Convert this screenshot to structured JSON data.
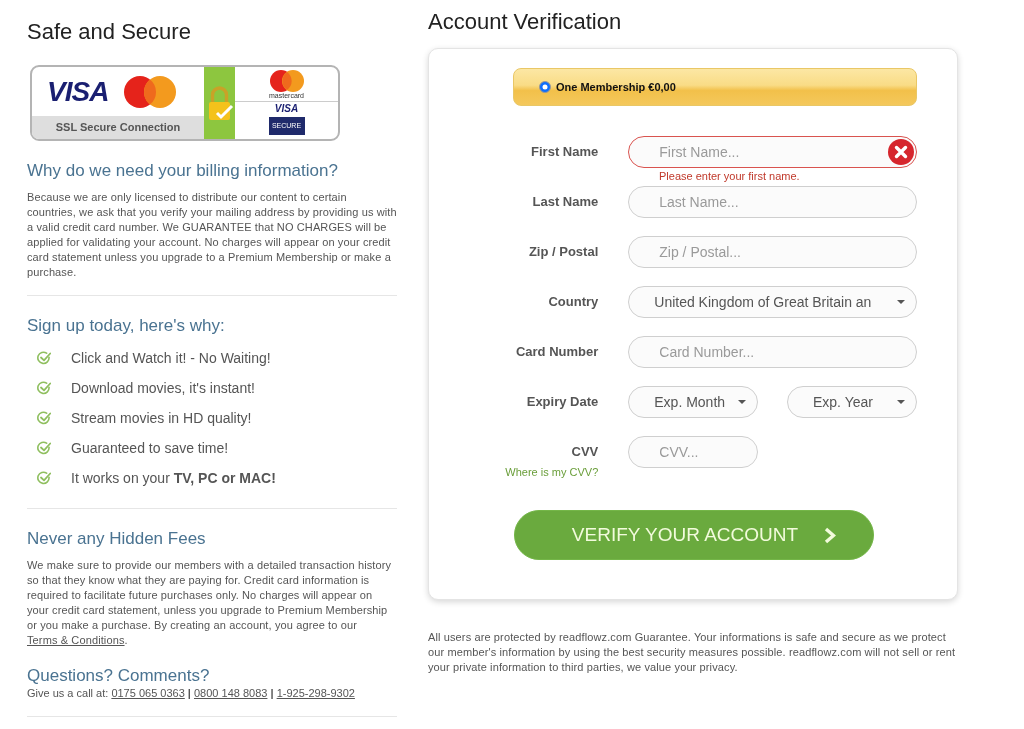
{
  "sidebar": {
    "title": "Safe and Secure",
    "security_badge": {
      "brand_text": "VISA",
      "ssl_text": "SSL Secure Connection",
      "mastercard_text": "mastercard",
      "small_brand_text": "VISA",
      "secure_text": "SECURE"
    },
    "billing_info": {
      "heading": "Why do we need your billing information?",
      "text": "Because we are only licensed to distribute our content to certain countries, we ask that you verify your mailing address by providing us with a valid credit card number. We GUARANTEE that NO CHARGES will be applied for validating your account. No charges will appear on your credit card statement unless you upgrade to a Premium Membership or make a purchase."
    },
    "benefits": {
      "heading": "Sign up today, here's why:",
      "items": [
        "Click and Watch it! - No Waiting!",
        "Download movies, it's instant!",
        "Stream movies in HD quality!",
        "Guaranteed to save time!",
        "It works on your **TV, PC or MAC!**"
      ]
    },
    "hidden_fees": {
      "heading": "Never any Hidden Fees",
      "text": "We make sure to provide our members with a detailed transaction history so that they know what they are paying for. Credit card information is required to facilitate future purchases only. No charges will appear on your credit card statement, unless you upgrade to Premium Membership or you make a purchase. By creating an account, you agree to our",
      "link": "Terms & Conditions",
      "text_end": "."
    },
    "contact": {
      "heading": "Questions? Comments?",
      "text": "Give us a call at:",
      "phones": [
        "0175 065 0363",
        "0800 148 8083",
        "1-925-298-9302"
      ],
      "separators": [
        "|",
        "|"
      ]
    }
  },
  "verification": {
    "title": "Account Verification",
    "membership": {
      "label": "One Membership €0,00",
      "selected": true
    },
    "fields": [
      {
        "kind": "text",
        "label": "First Name",
        "placeholder": "First Name...",
        "invalid": true,
        "error": "Please enter your first name."
      },
      {
        "kind": "text",
        "label": "Last Name",
        "placeholder": "Last Name...",
        "invalid": false
      },
      {
        "kind": "text",
        "label": "Zip / Postal",
        "placeholder": "Zip / Postal...",
        "invalid": false
      },
      {
        "kind": "select",
        "label": "Country",
        "value": "United Kingdom of Great Britain an",
        "invalid": false
      },
      {
        "kind": "text",
        "label": "Card Number",
        "placeholder": "Card Number...",
        "invalid": false
      },
      {
        "kind": "select_pair",
        "label": "Expiry Date",
        "values": [
          "Exp. Month",
          "Exp. Year"
        ],
        "invalid": false
      },
      {
        "kind": "short_text",
        "label": "CVV",
        "placeholder": "CVV...",
        "invalid": false,
        "help_link": "Where is my CVV?"
      }
    ],
    "submit_button": "VERIFY YOUR ACCOUNT",
    "privacy_note": "All users are protected by readflowz.com Guarantee. Your informations is safe and secure as we protect our member's information by using the best security measures possible. readflowz.com will not sell or rent your private information to third parties, we value your privacy."
  }
}
